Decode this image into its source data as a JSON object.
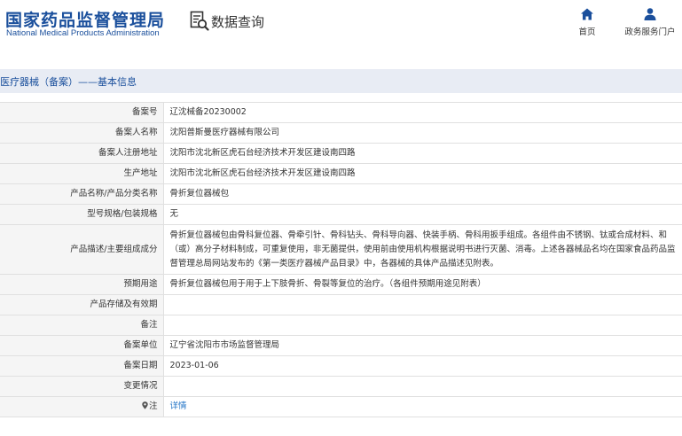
{
  "header": {
    "logo_cn": "国家药品监督管理局",
    "logo_en": "National Medical Products Administration",
    "query_label": "数据查询",
    "nav": [
      {
        "label": "首页",
        "icon": "home-icon"
      },
      {
        "label": "政务服务门户",
        "icon": "user-icon"
      }
    ]
  },
  "section": {
    "title": "医疗器械（备案）——基本信息"
  },
  "rows": [
    {
      "label": "备案号",
      "value": "辽沈械备20230002"
    },
    {
      "label": "备案人名称",
      "value": "沈阳普斯曼医疗器械有限公司"
    },
    {
      "label": "备案人注册地址",
      "value": "沈阳市沈北新区虎石台经济技术开发区建设南四路"
    },
    {
      "label": "生产地址",
      "value": "沈阳市沈北新区虎石台经济技术开发区建设南四路"
    },
    {
      "label": "产品名称/产品分类名称",
      "value": "骨折复位器械包"
    },
    {
      "label": "型号规格/包装规格",
      "value": "无"
    },
    {
      "label": "产品描述/主要组成成分",
      "value": "骨折复位器械包由骨科复位器、骨牵引针、骨科钻头、骨科导向器、快装手柄、骨科用扳手组成。各组件由不锈钢、钛或合成材料、和（或）高分子材料制成，可重复使用，非无菌提供，使用前由使用机构根据说明书进行灭菌、消毒。上述各器械品名均在国家食品药品监督管理总局网站发布的《第一类医疗器械产品目录》中，各器械的具体产品描述见附表。"
    },
    {
      "label": "预期用途",
      "value": "骨折复位器械包用于用于上下肢骨折、骨裂等复位的治疗。（各组件预期用途见附表）"
    },
    {
      "label": "产品存储及有效期",
      "value": ""
    },
    {
      "label": "备注",
      "value": ""
    },
    {
      "label": "备案单位",
      "value": "辽宁省沈阳市市场监督管理局"
    },
    {
      "label": "备案日期",
      "value": "2023-01-06"
    },
    {
      "label": "变更情况",
      "value": ""
    },
    {
      "label": "注",
      "value": "详情"
    }
  ],
  "colors": {
    "brand_blue": "#1a4f9c",
    "link_blue": "#1a6fc4",
    "label_bg": "#f5f5f5",
    "title_bar_bg": "#e8ecf4"
  }
}
